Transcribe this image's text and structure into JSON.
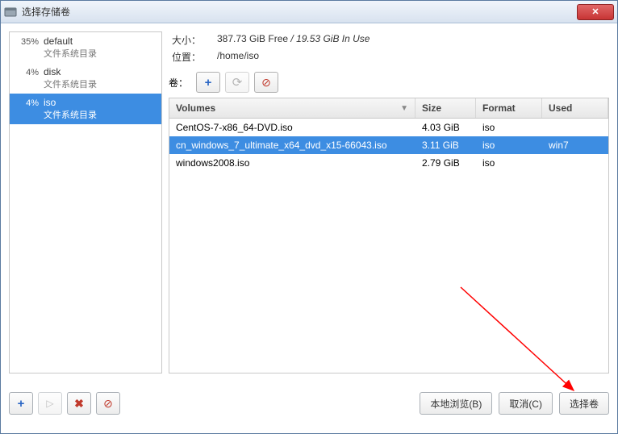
{
  "window": {
    "title": "选择存储卷"
  },
  "sidebar": {
    "items": [
      {
        "percent": "35%",
        "name": "default",
        "sub": "文件系统目录",
        "selected": false
      },
      {
        "percent": "4%",
        "name": "disk",
        "sub": "文件系统目录",
        "selected": false
      },
      {
        "percent": "4%",
        "name": "iso",
        "sub": "文件系统目录",
        "selected": true
      }
    ]
  },
  "info": {
    "size_label": "大小：",
    "size_free": "387.73 GiB Free",
    "size_sep": " / ",
    "size_used": "19.53 GiB In Use",
    "loc_label": "位置：",
    "loc_value": "/home/iso",
    "vol_label": "卷："
  },
  "table": {
    "headers": {
      "volumes": "Volumes",
      "size": "Size",
      "format": "Format",
      "used": "Used"
    },
    "rows": [
      {
        "name": "CentOS-7-x86_64-DVD.iso",
        "size": "4.03 GiB",
        "format": "iso",
        "used": "",
        "selected": false
      },
      {
        "name": "cn_windows_7_ultimate_x64_dvd_x15-66043.iso",
        "size": "3.11 GiB",
        "format": "iso",
        "used": "win7",
        "selected": true
      },
      {
        "name": "windows2008.iso",
        "size": "2.79 GiB",
        "format": "iso",
        "used": "",
        "selected": false
      }
    ]
  },
  "footer": {
    "browse": "本地浏览(B)",
    "cancel": "取消(C)",
    "select": "选择卷"
  },
  "icons": {
    "plus": "+",
    "refresh": "⟳",
    "stop": "⊘",
    "play": "▷",
    "delete": "✖",
    "close": "✕",
    "sort_desc": "▼"
  },
  "colors": {
    "selection": "#3d8de2",
    "close_btn": "#c73434",
    "arrow": "#ff0000"
  }
}
